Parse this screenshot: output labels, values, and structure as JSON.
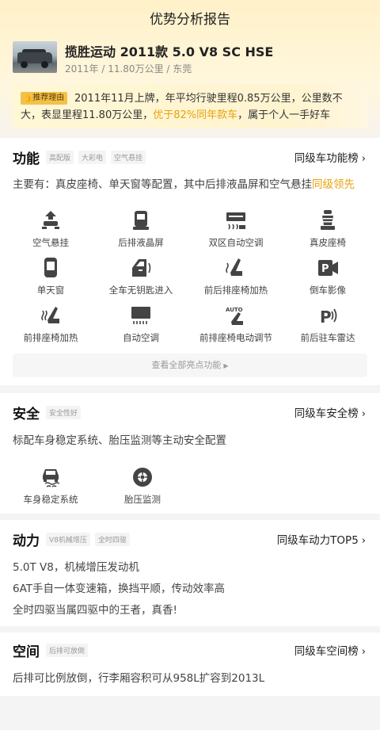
{
  "page": {
    "title": "优势分析报告"
  },
  "car": {
    "name": "揽胜运动 2011款 5.0 V8 SC HSE",
    "meta": "2011年 / 11.80万公里 / 东莞"
  },
  "recommend": {
    "tag": "推荐理由",
    "text_before": "2011年11月上牌，年平均行驶里程0.85万公里，公里数不大，表显里程11.80万公里，",
    "text_highlight": "优于82%同年款车",
    "text_after": "，属于个人一手好车"
  },
  "features": {
    "title": "功能",
    "tags": [
      "高配版",
      "大彩电",
      "空气悬挂"
    ],
    "rank_link": "同级车功能榜",
    "desc_before": "主要有：真皮座椅、单天窗等配置，其中后排液晶屏和空气悬挂",
    "desc_highlight": "同级领先",
    "items": [
      {
        "label": "空气悬挂",
        "icon": "air-suspension-icon"
      },
      {
        "label": "后排液晶屏",
        "icon": "rear-screen-icon"
      },
      {
        "label": "双区自动空调",
        "icon": "dual-zone-ac-icon"
      },
      {
        "label": "真皮座椅",
        "icon": "leather-seat-icon"
      },
      {
        "label": "单天窗",
        "icon": "sunroof-icon"
      },
      {
        "label": "全车无钥匙进入",
        "icon": "keyless-entry-icon"
      },
      {
        "label": "前后排座椅加热",
        "icon": "seat-heating-icon"
      },
      {
        "label": "倒车影像",
        "icon": "reverse-camera-icon"
      },
      {
        "label": "前排座椅加热",
        "icon": "front-seat-heating-icon"
      },
      {
        "label": "自动空调",
        "icon": "auto-ac-icon"
      },
      {
        "label": "前排座椅电动调节",
        "icon": "power-seat-icon"
      },
      {
        "label": "前后驻车雷达",
        "icon": "parking-radar-icon"
      }
    ],
    "more_label": "查看全部亮点功能"
  },
  "safety": {
    "title": "安全",
    "tags": [
      "安全性好"
    ],
    "rank_link": "同级车安全榜",
    "desc": "标配车身稳定系统、胎压监测等主动安全配置",
    "items": [
      {
        "label": "车身稳定系统",
        "icon": "stability-control-icon"
      },
      {
        "label": "胎压监测",
        "icon": "tire-pressure-icon"
      }
    ]
  },
  "power": {
    "title": "动力",
    "tags": [
      "V8机械增压",
      "全时四驱"
    ],
    "rank_link": "同级车动力TOP5",
    "lines": [
      "5.0T V8，机械增压发动机",
      "6AT手自一体变速箱，换挡平顺，传动效率高",
      "全时四驱当属四驱中的王者，真香!"
    ]
  },
  "space": {
    "title": "空间",
    "tags": [
      "后排可放倒"
    ],
    "rank_link": "同级车空间榜",
    "desc": "后排可比例放倒，行李厢容积可从958L扩容到2013L"
  },
  "colors": {
    "accent": "#e8a20b",
    "tag_bg": "#f3c14a",
    "icon": "#444444"
  }
}
